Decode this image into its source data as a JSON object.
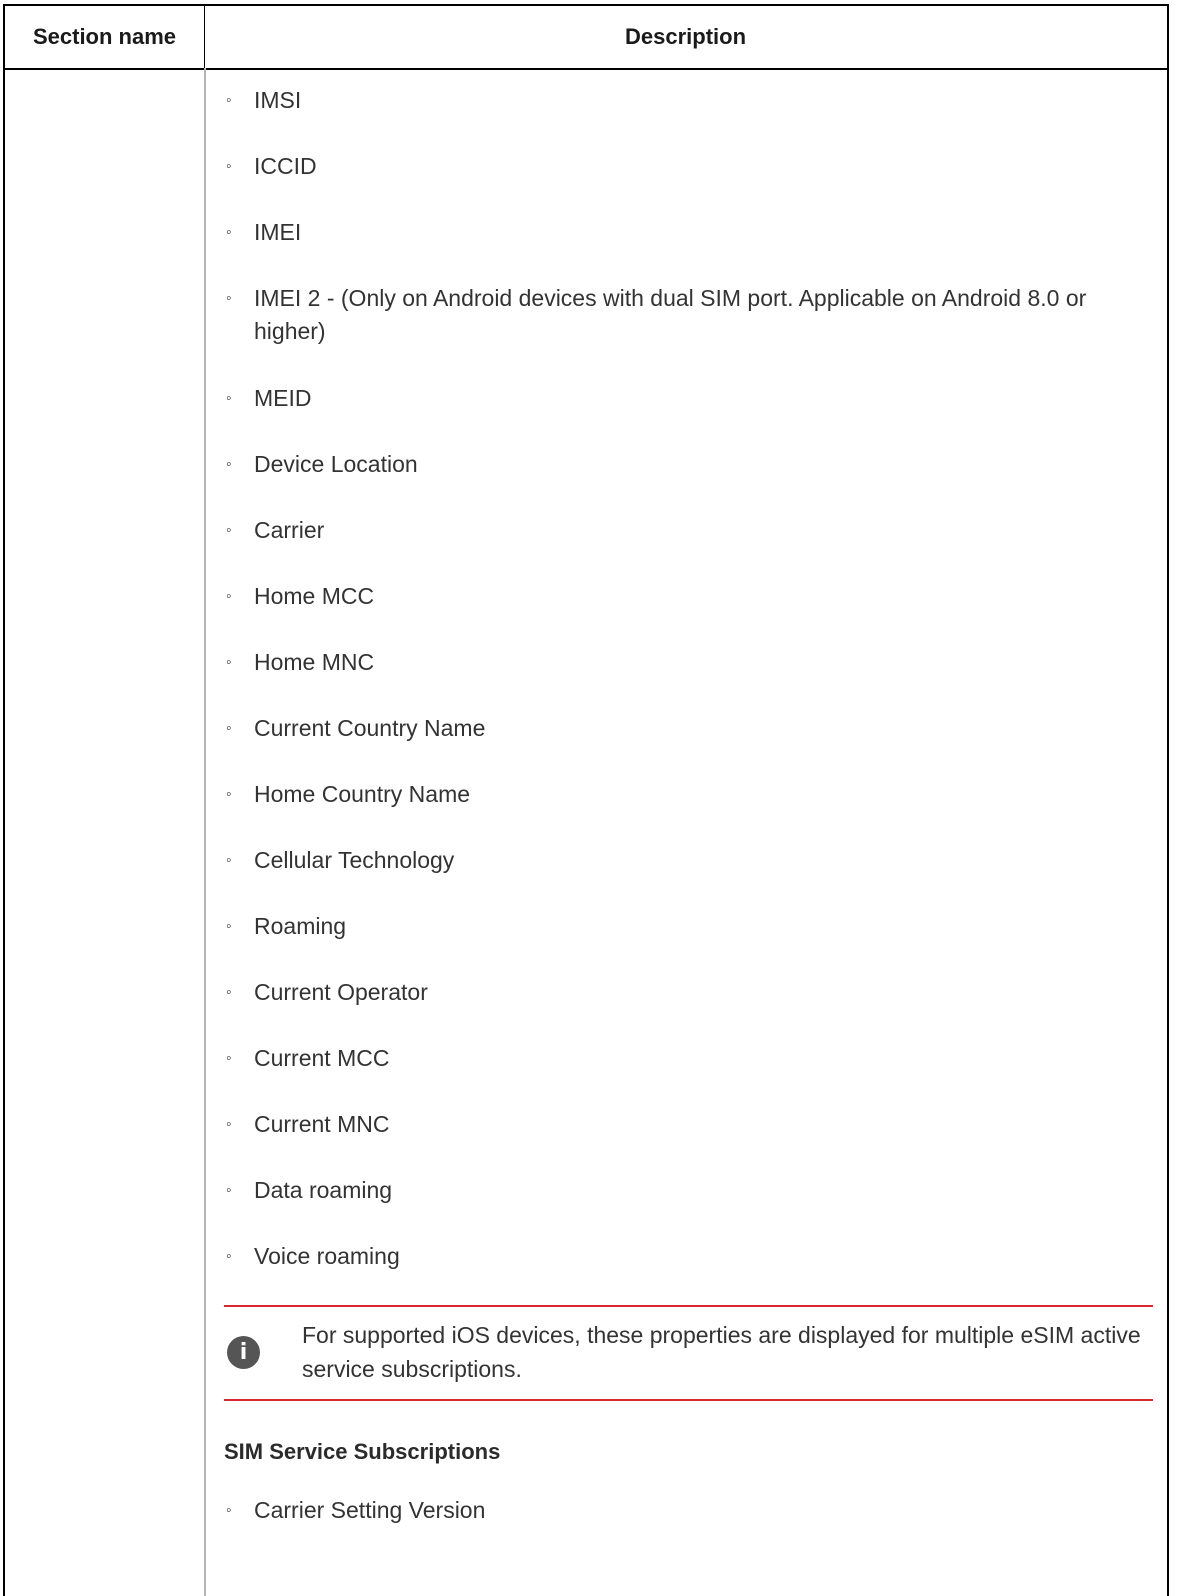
{
  "table": {
    "headers": {
      "section_name": "Section name",
      "description": "Description"
    }
  },
  "content": {
    "items": [
      "IMSI",
      "ICCID",
      "IMEI",
      "IMEI 2 - (Only on Android devices with dual SIM port. Applicable on Android 8.0 or higher)",
      "MEID",
      "Device Location",
      "Carrier",
      "Home MCC",
      "Home MNC",
      "Current Country Name",
      "Home Country Name",
      "Cellular Technology",
      "Roaming",
      "Current Operator",
      "Current MCC",
      "Current MNC",
      "Data roaming",
      "Voice roaming"
    ],
    "note": {
      "icon": "info-icon",
      "text": "For supported iOS devices, these properties are displayed for multiple eSIM active service subscriptions."
    },
    "subheading": "SIM Service Subscriptions",
    "sub_items": [
      "Carrier Setting Version"
    ]
  },
  "colors": {
    "note_rule": "#d9282f",
    "border": "#000000",
    "column_rule": "#b5b5b5",
    "info_icon_bg": "#555555"
  }
}
